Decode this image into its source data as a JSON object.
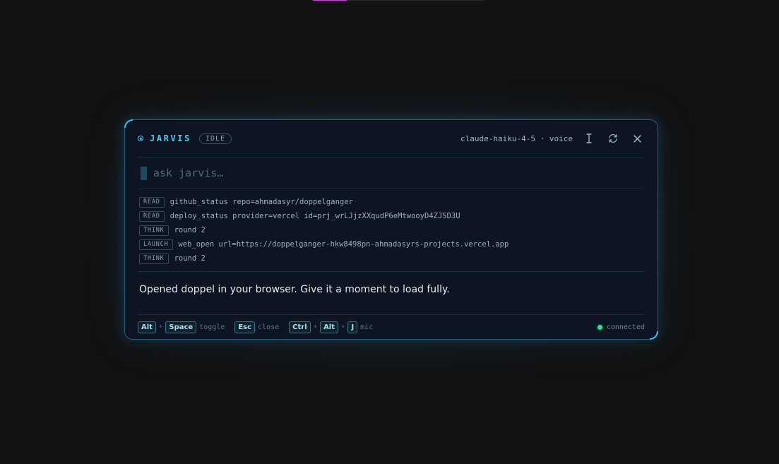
{
  "colors": {
    "accent": "#52ccf2",
    "progress": "#c93fd8",
    "connected": "#3fd98a"
  },
  "progress": {
    "fraction": 0.2
  },
  "header": {
    "title": "JARVIS",
    "state": "IDLE",
    "model": "claude-haiku-4-5 · voice",
    "icons": [
      "text-cursor-icon",
      "refresh-icon",
      "close-icon"
    ]
  },
  "input": {
    "placeholder": "ask jarvis…",
    "value": ""
  },
  "log": [
    {
      "tag": "READ",
      "text": "github_status repo=ahmadasyr/doppelganger"
    },
    {
      "tag": "READ",
      "text": "deploy_status provider=vercel id=prj_wrLJjzXXqudP6eMtwooyD4ZJSD3U"
    },
    {
      "tag": "THINK",
      "text": "round 2"
    },
    {
      "tag": "LAUNCH",
      "text": "web_open url=https://doppelganger-hkw8498pn-ahmadasyrs-projects.vercel.app"
    },
    {
      "tag": "THINK",
      "text": "round 2"
    }
  ],
  "response": "Opened doppel in your browser. Give it a moment to load fully.",
  "footer": {
    "shortcuts": [
      {
        "keys": [
          "Alt",
          "Space"
        ],
        "label": "toggle"
      },
      {
        "keys": [
          "Esc"
        ],
        "label": "close"
      },
      {
        "keys": [
          "Ctrl",
          "Alt",
          "J"
        ],
        "label": "mic"
      }
    ],
    "connection": "connected"
  }
}
